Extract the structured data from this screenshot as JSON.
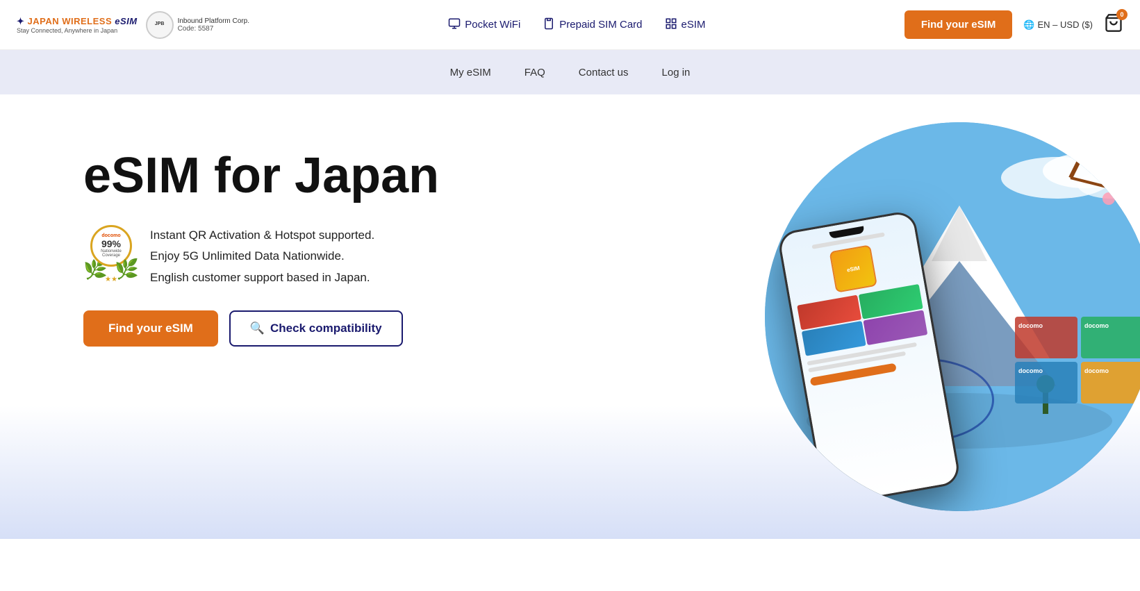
{
  "brand": {
    "name_part1": "JAPAN WIRELESS ",
    "name_part2": "eSIM",
    "tagline": "Stay Connected, Anywhere in Japan",
    "badge_company": "Inbound Platform Corp.",
    "badge_code_label": "Code: 5587",
    "badge_circle_text": "JPB"
  },
  "top_nav": {
    "items": [
      {
        "id": "pocket-wifi",
        "label": "Pocket WiFi",
        "icon": "wifi-icon"
      },
      {
        "id": "prepaid-sim",
        "label": "Prepaid SIM Card",
        "icon": "sim-icon"
      },
      {
        "id": "esim",
        "label": "eSIM",
        "icon": "esim-icon"
      }
    ],
    "find_esim_btn": "Find your eSIM",
    "lang": "EN – USD ($)",
    "cart_count": "0"
  },
  "sub_nav": {
    "items": [
      {
        "id": "my-esim",
        "label": "My eSIM"
      },
      {
        "id": "faq",
        "label": "FAQ"
      },
      {
        "id": "contact",
        "label": "Contact us"
      },
      {
        "id": "login",
        "label": "Log in"
      }
    ]
  },
  "hero": {
    "title": "eSIM for Japan",
    "docomo_pct": "99%",
    "docomo_label": "docomo",
    "docomo_sub": "Nationwide\nCoverage",
    "features": [
      "Instant QR Activation & Hotspot supported.",
      "Enjoy 5G Unlimited Data Nationwide.",
      "English customer support based in Japan."
    ],
    "btn_find_esim": "Find your eSIM",
    "btn_check_compat": "Check compatibility",
    "search_icon": "🔍"
  }
}
